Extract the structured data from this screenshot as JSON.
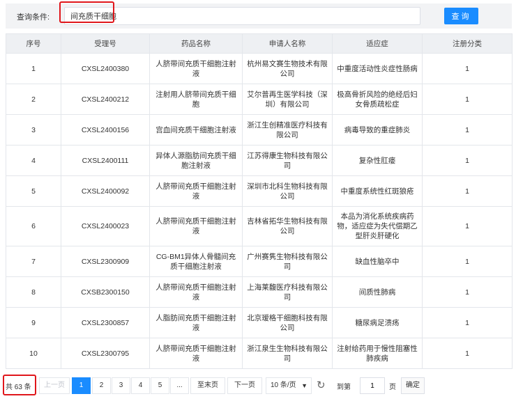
{
  "query": {
    "label": "查询条件:",
    "value": "间充质干细胞",
    "button": "查询"
  },
  "table": {
    "headers": [
      "序号",
      "受理号",
      "药品名称",
      "申请人名称",
      "适应症",
      "注册分类"
    ],
    "rows": [
      [
        "1",
        "CXSL2400380",
        "人脐带间充质干细胞注射液",
        "杭州易文赛生物技术有限公司",
        "中重度活动性炎症性肠病",
        "1"
      ],
      [
        "2",
        "CXSL2400212",
        "注射用人脐带间充质干细胞",
        "艾尔普再生医学科技（深圳）有限公司",
        "极高骨折风险的绝经后妇女骨质疏松症",
        "1"
      ],
      [
        "3",
        "CXSL2400156",
        "宫血间充质干细胞注射液",
        "浙江生创精准医疗科技有限公司",
        "病毒导致的重症肺炎",
        "1"
      ],
      [
        "4",
        "CXSL2400111",
        "异体人源脂肪间充质干细胞注射液",
        "江苏得康生物科技有限公司",
        "复杂性肛瘘",
        "1"
      ],
      [
        "5",
        "CXSL2400092",
        "人脐带间充质干细胞注射液",
        "深圳市北科生物科技有限公司",
        "中重度系统性红斑狼疮",
        "1"
      ],
      [
        "6",
        "CXSL2400023",
        "人脐带间充质干细胞注射液",
        "吉林省拓华生物科技有限公司",
        "本品为消化系统疾病药物，适应症为失代偿期乙型肝炎肝硬化",
        "1"
      ],
      [
        "7",
        "CXSL2300909",
        "CG-BM1异体人骨髓间充质干细胞注射液",
        "广州赛隽生物科技有限公司",
        "缺血性脑卒中",
        "1"
      ],
      [
        "8",
        "CXSB2300150",
        "人脐带间充质干细胞注射液",
        "上海莱馥医疗科技有限公司",
        "间质性肺病",
        "1"
      ],
      [
        "9",
        "CXSL2300857",
        "人脂肪间充质干细胞注射液",
        "北京瑷格干细胞科技有限公司",
        "糖尿病足溃疡",
        "1"
      ],
      [
        "10",
        "CXSL2300795",
        "人脐带间充质干细胞注射液",
        "浙江泉生生物科技有限公司",
        "注射给药用于慢性阻塞性肺疾病",
        "1"
      ]
    ]
  },
  "pager": {
    "total": "共 63 条",
    "prev": "上一页",
    "pages": [
      "1",
      "2",
      "3",
      "4",
      "5"
    ],
    "active_page": "1",
    "ellipsis": "...",
    "last": "至末页",
    "next": "下一页",
    "page_size": "10 条/页",
    "goto_label": "到第",
    "goto_value": "1",
    "page_unit": "页",
    "confirm": "确定",
    "icons": {
      "refresh": "refresh-icon",
      "chevron": "chevron-down-icon"
    }
  },
  "colors": {
    "primary": "#1a8cff",
    "highlight": "#e0161b",
    "header_bg": "#eef0f3",
    "query_bg": "#f2f3f5"
  }
}
